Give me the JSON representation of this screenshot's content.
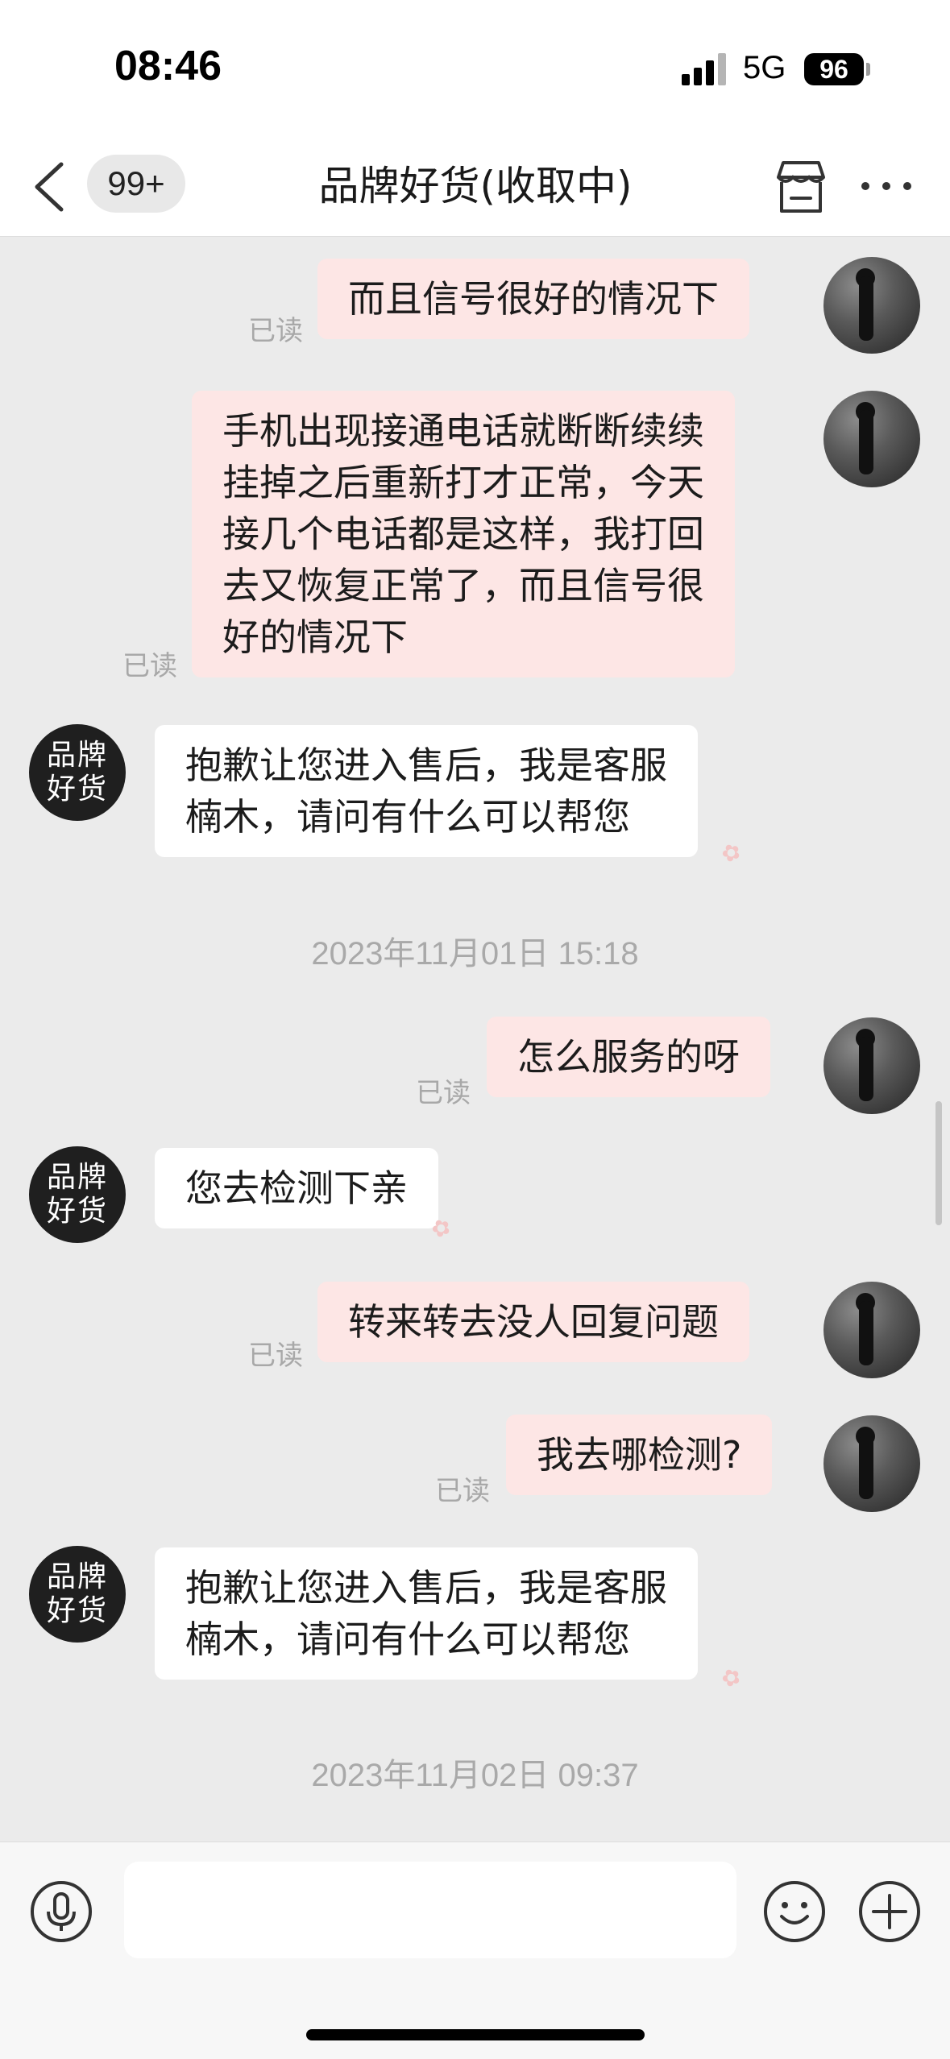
{
  "status_bar": {
    "time": "08:46",
    "network": "5G",
    "battery": "96"
  },
  "nav": {
    "unread_count": "99+",
    "title": "品牌好货(收取中)"
  },
  "read_label": "已读",
  "brand_avatar": {
    "line1": "品牌",
    "line2": "好货"
  },
  "messages": [
    {
      "text": "而且信号很好的情况下"
    },
    {
      "text": "手机出现接通电话就断断续续\n挂掉之后重新打才正常，今天\n接几个电话都是这样，我打回\n去又恢复正常了，而且信号很\n好的情况下"
    },
    {
      "text": "抱歉让您进入售后，我是客服\n楠木，请问有什么可以帮您"
    },
    {
      "text": "怎么服务的呀"
    },
    {
      "text": "您去检测下亲"
    },
    {
      "text": "转来转去没人回复问题"
    },
    {
      "text": "我去哪检测?"
    },
    {
      "text": "抱歉让您进入售后，我是客服\n楠木，请问有什么可以帮您"
    }
  ],
  "timestamps": [
    "2023年11月01日 15:18",
    "2023年11月02日 09:37"
  ],
  "input": {
    "value": "",
    "placeholder": ""
  },
  "icons": [
    "back-arrow-icon",
    "store-icon",
    "more-icon",
    "microphone-icon",
    "emoji-icon",
    "plus-icon"
  ]
}
